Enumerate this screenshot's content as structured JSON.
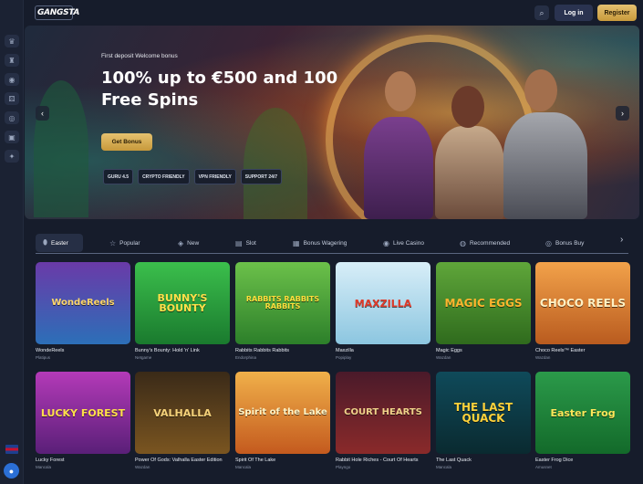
{
  "header": {
    "logo_text": "GANGSTA",
    "login_label": "Log in",
    "register_label": "Register",
    "search_icon": "search-icon"
  },
  "sidebar": {
    "icons": [
      "crown-icon",
      "trophy-icon",
      "casino-icon",
      "dice-icon",
      "chip-icon",
      "live-icon",
      "gift-icon"
    ],
    "language": "en-gb-flag",
    "chat_icon": "chat-icon"
  },
  "banner": {
    "kicker": "First deposit Welcome bonus",
    "title": "100% up to €500 and 100 Free Spins",
    "cta": "Get Bonus",
    "badges": [
      "GURU 4.5",
      "CRYPTO FRIENDLY",
      "VPN FRIENDLY",
      "SUPPORT 24/7"
    ],
    "slides_total": 7,
    "active_slide": 3
  },
  "tabs": [
    {
      "label": "Easter",
      "icon": "egg-icon",
      "active": true
    },
    {
      "label": "Popular",
      "icon": "star-icon",
      "active": false
    },
    {
      "label": "New",
      "icon": "new-icon",
      "active": false
    },
    {
      "label": "Slot",
      "icon": "slot-icon",
      "active": false
    },
    {
      "label": "Bonus Wagering",
      "icon": "wager-icon",
      "active": false
    },
    {
      "label": "Live Casino",
      "icon": "live-icon",
      "active": false
    },
    {
      "label": "Recommended",
      "icon": "thumb-icon",
      "active": false
    },
    {
      "label": "Bonus Buy",
      "icon": "buy-icon",
      "active": false
    }
  ],
  "games": [
    {
      "name": "WondeReels",
      "provider": "Platipus",
      "art": "WondeReels"
    },
    {
      "name": "Bunny's Bounty: Hold 'n' Link",
      "provider": "Netgame",
      "art": "BUNNY'S BOUNTY"
    },
    {
      "name": "Rabbits Rabbits Rabbits",
      "provider": "Endorphina",
      "art": "RABBITS RABBITS RABBITS"
    },
    {
      "name": "Maxzilla",
      "provider": "Popiplay",
      "art": "MAXZILLA"
    },
    {
      "name": "Magic Eggs",
      "provider": "Wazdan",
      "art": "MAGIC EGGS"
    },
    {
      "name": "Choco Reels™ Easter",
      "provider": "Wazdan",
      "art": "CHOCO REELS"
    },
    {
      "name": "Lucky Forest",
      "provider": "Mancala",
      "art": "LUCKY FOREST"
    },
    {
      "name": "Power Of Gods: Valhalla Easter Edition",
      "provider": "Wazdan",
      "art": "VALHALLA"
    },
    {
      "name": "Spirit Of The Lake",
      "provider": "Mancala",
      "art": "Spirit of the Lake"
    },
    {
      "name": "Rabbit Hole Riches - Court Of Hearts",
      "provider": "Playngo",
      "art": "COURT HEARTS"
    },
    {
      "name": "The Last Quack",
      "provider": "Mancala",
      "art": "THE LAST QUACK"
    },
    {
      "name": "Easter Frog Dice",
      "provider": "Amusnet",
      "art": "Easter Frog"
    }
  ],
  "colors": {
    "background": "#161c2b",
    "accent_gold": "#d8b25a",
    "panel": "#262f45"
  }
}
